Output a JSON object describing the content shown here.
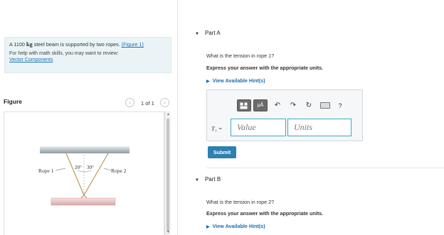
{
  "problem": {
    "text_prefix": "A 1100 ",
    "unit": "kg",
    "text_suffix": " steel beam is supported by two ropes. ",
    "figure_link": "(Figure 1)",
    "help_text": "For help with math skills, you may want to review:",
    "help_link": "Vector Components"
  },
  "figure": {
    "label": "Figure",
    "nav_prev": "‹",
    "nav_count": "1 of 1",
    "nav_next": "›",
    "rope1": "Rope 1",
    "rope2": "Rope 2",
    "angle1": "20°",
    "angle2": "30°"
  },
  "part_a": {
    "title": "Part A",
    "question": "What is the tension in rope 1?",
    "instruction": "Express your answer with the appropriate units.",
    "hint": "View Available Hint(s)",
    "toolbar": {
      "templates_icon": "templates-icon",
      "units_label": "μÅ",
      "undo_icon": "undo-icon",
      "redo_icon": "redo-icon",
      "reset_icon": "reset-icon",
      "keyboard_icon": "keyboard-icon",
      "help_label": "?"
    },
    "variable_label": "T₁ =",
    "value_placeholder": "Value",
    "units_placeholder": "Units",
    "submit_label": "Submit"
  },
  "part_b": {
    "title": "Part B",
    "question": "What is the tension in rope 2?",
    "instruction": "Express your answer with the appropriate units.",
    "hint": "View Available Hint(s)"
  },
  "colors": {
    "accent": "#2f7fb0",
    "link": "#1a6fb6",
    "input_border": "#42a5c7",
    "problem_bg": "#eaf4f6"
  }
}
